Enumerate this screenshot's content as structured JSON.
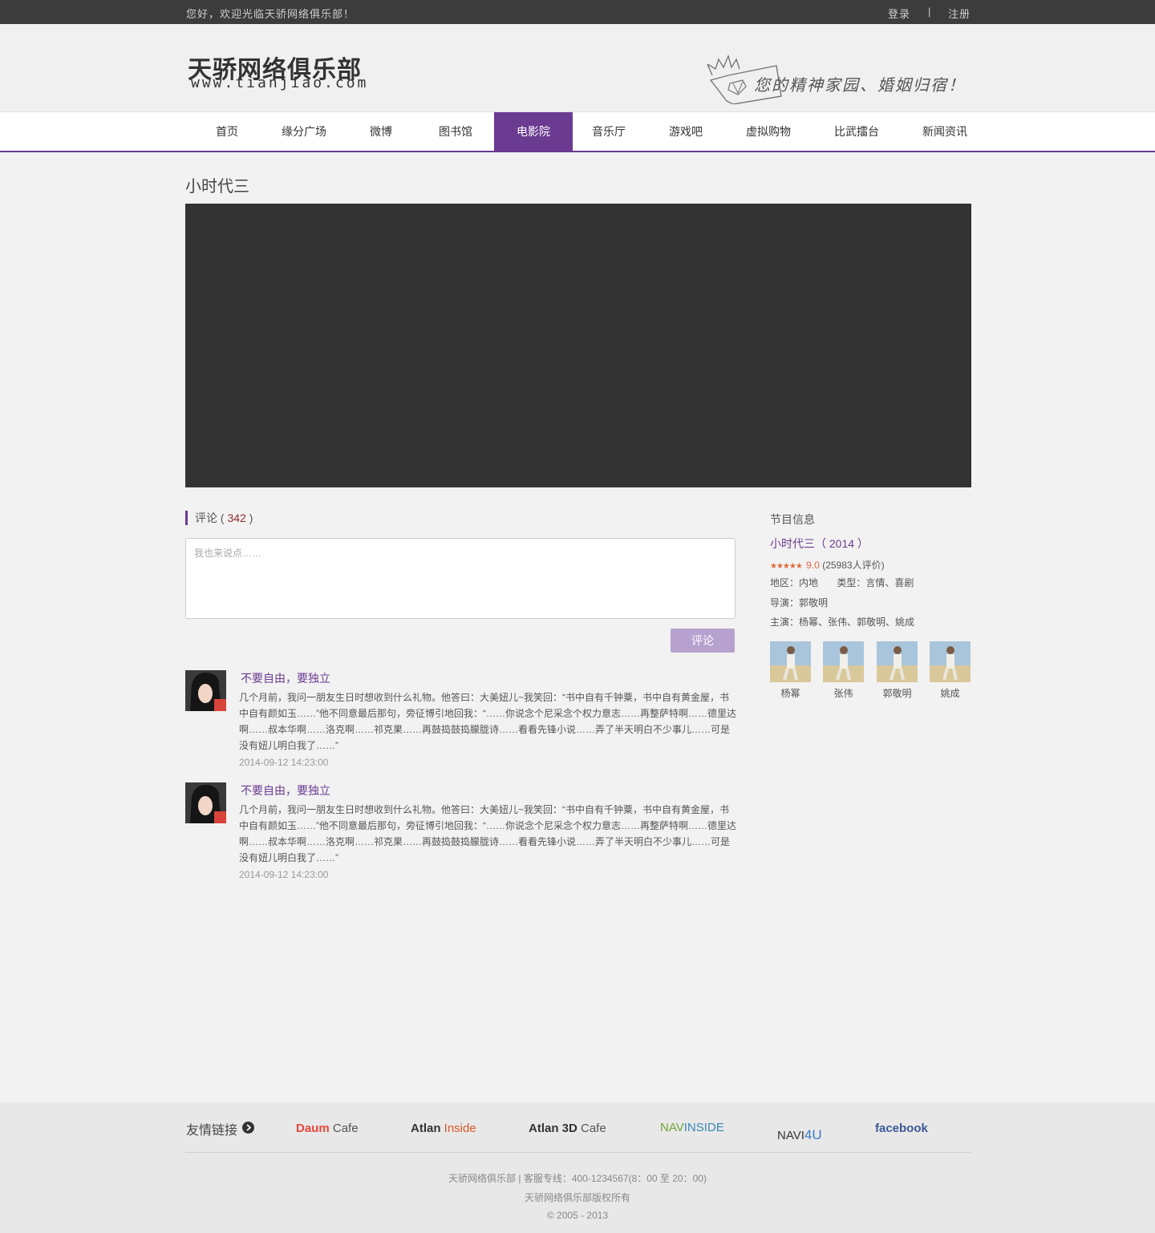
{
  "topbar": {
    "welcome": "您好，欢迎光临天骄网络俱乐部！",
    "login": "登录",
    "separator": "|",
    "register": "注册"
  },
  "header": {
    "logo_cn": "天骄网络俱乐部",
    "logo_url": "www.tianjiao.com",
    "slogan": "您的精神家园、婚姻归宿！"
  },
  "nav": {
    "items": [
      {
        "label": "首页",
        "active": false
      },
      {
        "label": "缘分广场",
        "active": false
      },
      {
        "label": "微博",
        "active": false
      },
      {
        "label": "图书馆",
        "active": false
      },
      {
        "label": "电影院",
        "active": true
      },
      {
        "label": "音乐厅",
        "active": false
      },
      {
        "label": "游戏吧",
        "active": false
      },
      {
        "label": "虚拟购物",
        "active": false
      },
      {
        "label": "比武擂台",
        "active": false
      },
      {
        "label": "新闻资讯",
        "active": false
      }
    ]
  },
  "main": {
    "title": "小时代三",
    "comments": {
      "label": "评论",
      "paren_open": "(",
      "count": "342",
      "paren_close": ")",
      "placeholder": "我也来说点……",
      "submit": "评论",
      "list": [
        {
          "user": "不要自由，要独立",
          "text": "几个月前，我问一朋友生日时想收到什么礼物。他答曰：大美妞儿~我笑回：“书中自有千钟粟，书中自有黄金屋，书中自有颜如玉……”他不同意最后那句，旁征博引地回我：“……你说念个尼采念个权力意志……再整萨特啊……德里达啊……叔本华啊……洛克啊……祁克果……再鼓捣鼓捣朦胧诗……看看先锋小说……弄了半天明白不少事儿……可是没有妞儿明白我了……”",
          "time": "2014-09-12 14:23:00"
        },
        {
          "user": "不要自由，要独立",
          "text": "几个月前，我问一朋友生日时想收到什么礼物。他答曰：大美妞儿~我笑回：“书中自有千钟粟，书中自有黄金屋，书中自有颜如玉……”他不同意最后那句，旁征博引地回我：“……你说念个尼采念个权力意志……再整萨特啊……德里达啊……叔本华啊……洛克啊……祁克果……再鼓捣鼓捣朦胧诗……看看先锋小说……弄了半天明白不少事儿……可是没有妞儿明白我了……”",
          "time": "2014-09-12 14:23:00"
        }
      ]
    }
  },
  "info": {
    "heading": "节目信息",
    "title": "小时代三",
    "year": "（ 2014 ）",
    "stars": "★★★★★",
    "score": "9.0",
    "reviews": "(25983人评价)",
    "region": "地区：内地",
    "genre": "类型：言情、喜剧",
    "director": "导演：郭敬明",
    "cast_line": "主演：杨幂、张伟、郭敬明、姚成",
    "cast": [
      {
        "name": "杨幂"
      },
      {
        "name": "张伟"
      },
      {
        "name": "郭敬明"
      },
      {
        "name": "姚成"
      }
    ]
  },
  "footer": {
    "links_label": "友情链接",
    "partners": [
      {
        "a": "Daum",
        "b": " Cafe"
      },
      {
        "a": "Atlan",
        "b": " Inside"
      },
      {
        "a": "Atlan 3D",
        "b": " Cafe"
      },
      {
        "a": "NAV",
        "b": "INSIDE"
      },
      {
        "a": "NAVI",
        "b": "4U"
      },
      {
        "a": "facebook",
        "b": ""
      }
    ],
    "line1": "天骄网络俱乐部  |  客服专线：400-1234567(8：00 至 20：00)",
    "line2": "天骄网络俱乐部版权所有",
    "line3": "© 2005 - 2013"
  },
  "colors": {
    "accent": "#6b3a91",
    "topbar": "#3c3c3c",
    "player": "#333333",
    "button": "#b7a2cf",
    "star": "#e0683c"
  }
}
